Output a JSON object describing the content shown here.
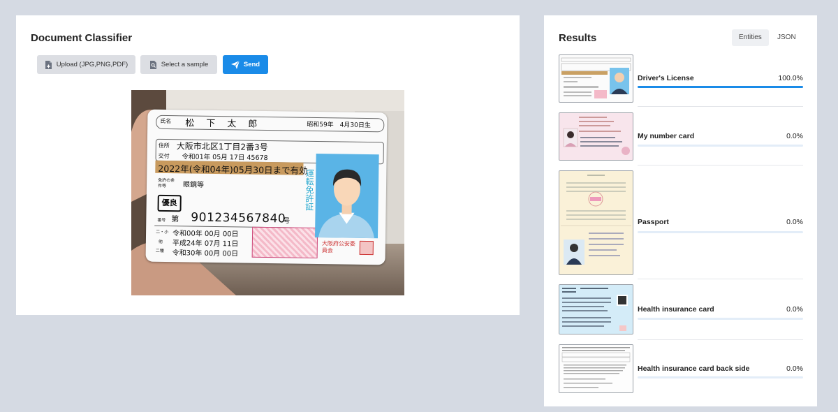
{
  "classifier": {
    "title": "Document Classifier",
    "upload_label": "Upload (JPG,PNG,PDF)",
    "sample_label": "Select a sample",
    "send_label": "Send"
  },
  "license": {
    "name_label": "氏名",
    "name": "松　下　太　郎",
    "birth": "昭和59年　4月30日生",
    "address_label": "住所",
    "address": "大阪市北区1丁目2番3号",
    "issue_label": "交付",
    "issue": "令和01年 05月 17日 45678",
    "expiry": "2022年(令和04年)05月30日まで有効",
    "conditions_label": "免許の条件等",
    "conditions": "眼鏡等",
    "status": "優良",
    "number_label": "番号",
    "number_prefix": "第",
    "number": "901234567840",
    "number_suffix": "号",
    "vertical_title": "運転免許証",
    "history_labels": [
      "二・小",
      "他",
      "二種"
    ],
    "history_dates": [
      "令和00年 00月 00日",
      "平成24年 07月 11日",
      "令和30年 00月 00日"
    ],
    "issuer": "大阪府公安委員会"
  },
  "results": {
    "title": "Results",
    "tabs": [
      "Entities",
      "JSON"
    ],
    "items": [
      {
        "label": "Driver's License",
        "percent_text": "100.0%",
        "value": 1.0
      },
      {
        "label": "My number card",
        "percent_text": "0.0%",
        "value": 0.0
      },
      {
        "label": "Passport",
        "percent_text": "0.0%",
        "value": 0.0
      },
      {
        "label": "Health insurance card",
        "percent_text": "0.0%",
        "value": 0.0
      },
      {
        "label": "Health insurance card back side",
        "percent_text": "0.0%",
        "value": 0.0
      }
    ]
  },
  "colors": {
    "accent": "#1a8be8",
    "license_expiry_band": "#c89a5e",
    "photo_bg": "#5ab4e6"
  }
}
